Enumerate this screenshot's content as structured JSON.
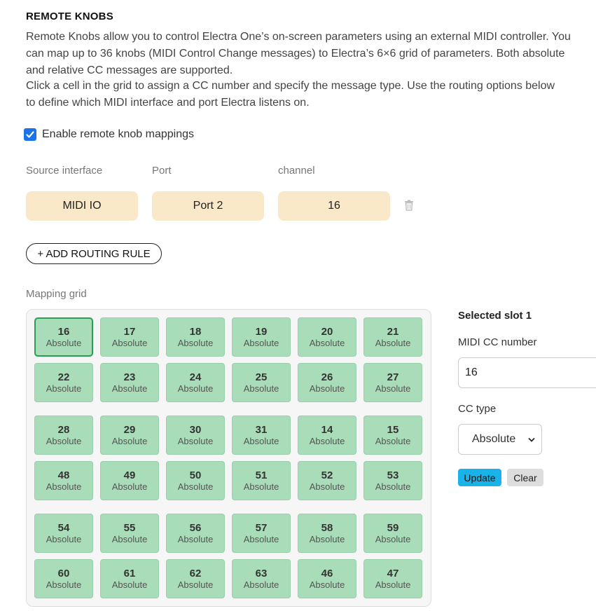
{
  "header": {
    "title": "REMOTE KNOBS",
    "intro_lines": [
      "Remote Knobs allow you to control Electra One’s on-screen parameters using an external MIDI controller. You",
      "can map up to 36 knobs (MIDI Control Change messages) to Electra’s 6×6 grid of parameters. Both absolute",
      "and relative CC messages are supported."
    ],
    "instructions_lines": [
      "Click a cell in the grid to assign a CC number and specify the message type. Use the routing options below",
      "to define which MIDI interface and port Electra listens on."
    ]
  },
  "enable": {
    "label": "Enable remote knob mappings",
    "checked": true
  },
  "routing": {
    "columns": {
      "source": "Source interface",
      "port": "Port",
      "channel": "channel"
    },
    "rule": {
      "source": "MIDI IO",
      "port": "Port 2",
      "channel": "16"
    },
    "add_rule_label": "+ ADD ROUTING RULE"
  },
  "grid": {
    "label": "Mapping grid",
    "selected_index": 0,
    "cells": [
      {
        "cc": "16",
        "type": "Absolute"
      },
      {
        "cc": "17",
        "type": "Absolute"
      },
      {
        "cc": "18",
        "type": "Absolute"
      },
      {
        "cc": "19",
        "type": "Absolute"
      },
      {
        "cc": "20",
        "type": "Absolute"
      },
      {
        "cc": "21",
        "type": "Absolute"
      },
      {
        "cc": "22",
        "type": "Absolute"
      },
      {
        "cc": "23",
        "type": "Absolute"
      },
      {
        "cc": "24",
        "type": "Absolute"
      },
      {
        "cc": "25",
        "type": "Absolute"
      },
      {
        "cc": "26",
        "type": "Absolute"
      },
      {
        "cc": "27",
        "type": "Absolute"
      },
      {
        "cc": "28",
        "type": "Absolute"
      },
      {
        "cc": "29",
        "type": "Absolute"
      },
      {
        "cc": "30",
        "type": "Absolute"
      },
      {
        "cc": "31",
        "type": "Absolute"
      },
      {
        "cc": "14",
        "type": "Absolute"
      },
      {
        "cc": "15",
        "type": "Absolute"
      },
      {
        "cc": "48",
        "type": "Absolute"
      },
      {
        "cc": "49",
        "type": "Absolute"
      },
      {
        "cc": "50",
        "type": "Absolute"
      },
      {
        "cc": "51",
        "type": "Absolute"
      },
      {
        "cc": "52",
        "type": "Absolute"
      },
      {
        "cc": "53",
        "type": "Absolute"
      },
      {
        "cc": "54",
        "type": "Absolute"
      },
      {
        "cc": "55",
        "type": "Absolute"
      },
      {
        "cc": "56",
        "type": "Absolute"
      },
      {
        "cc": "57",
        "type": "Absolute"
      },
      {
        "cc": "58",
        "type": "Absolute"
      },
      {
        "cc": "59",
        "type": "Absolute"
      },
      {
        "cc": "60",
        "type": "Absolute"
      },
      {
        "cc": "61",
        "type": "Absolute"
      },
      {
        "cc": "62",
        "type": "Absolute"
      },
      {
        "cc": "63",
        "type": "Absolute"
      },
      {
        "cc": "46",
        "type": "Absolute"
      },
      {
        "cc": "47",
        "type": "Absolute"
      }
    ]
  },
  "slot_editor": {
    "title": "Selected slot 1",
    "cc_label": "MIDI CC number",
    "cc_value": "16",
    "type_label": "CC type",
    "type_value": "Absolute",
    "update_label": "Update",
    "clear_label": "Clear"
  },
  "colors": {
    "cell_bg": "#a9dcb8",
    "cell_selected_border": "#2a9d55",
    "routing_bg": "#f9e9c8",
    "checkbox": "#1a73e8",
    "update_button": "#19b3ea"
  }
}
